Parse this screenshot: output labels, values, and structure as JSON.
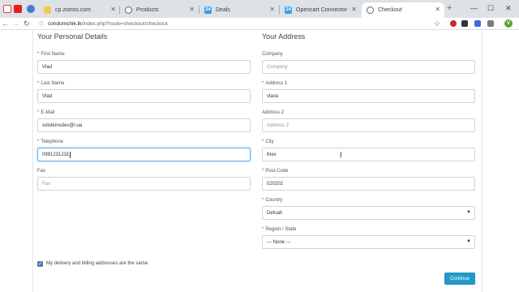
{
  "browser": {
    "tabs": [
      {
        "title": "cp.zomro.com",
        "icon": "folder-icon",
        "color": "#f2c94c"
      },
      {
        "title": "Products",
        "icon": "globe-icon",
        "color": "#5f6368"
      },
      {
        "title": "Deals",
        "icon": "bitrix24-icon",
        "color": "#2fa3e6",
        "badge": "24"
      },
      {
        "title": "Opencart Connector",
        "icon": "bitrix24-icon",
        "color": "#2fa3e6",
        "badge": "24"
      },
      {
        "title": "Checkout",
        "icon": "globe-icon",
        "color": "#5f6368",
        "active": true
      }
    ],
    "new_tab_label": "+",
    "url_host": "condomchik.tk",
    "url_path": "/index.php?route=checkout/checkout",
    "profile_initial": "V"
  },
  "personal": {
    "title": "Your Personal Details",
    "first_name": {
      "label": "First Name",
      "value": "Vlad",
      "required": true
    },
    "last_name": {
      "label": "Last Name",
      "value": "Vlad",
      "required": true
    },
    "email": {
      "label": "E-Mail",
      "value": "solutionsdev@i.ua",
      "required": true
    },
    "telephone": {
      "label": "Telephone",
      "value": "0991231231",
      "required": true
    },
    "fax": {
      "label": "Fax",
      "placeholder": "Fax",
      "required": false
    }
  },
  "address": {
    "title": "Your Address",
    "company": {
      "label": "Company",
      "placeholder": "Company",
      "required": false
    },
    "address1": {
      "label": "Address 1",
      "value": "vlava",
      "required": true
    },
    "address2": {
      "label": "Address 2",
      "placeholder": "Address 2",
      "required": false
    },
    "city": {
      "label": "City",
      "value": "Kiev",
      "required": true
    },
    "postcode": {
      "label": "Post Code",
      "value": "020202",
      "required": true
    },
    "country": {
      "label": "Country",
      "value": "Defualt",
      "required": true
    },
    "region": {
      "label": "Region / State",
      "value": "--- None ---",
      "required": true
    }
  },
  "same_address": {
    "label": "My delivery and billing addresses are the same.",
    "checked": true
  },
  "continue_label": "Continue",
  "colors": {
    "accent": "#229ac8",
    "required": "#e23a2e",
    "focus": "#66afe9"
  }
}
